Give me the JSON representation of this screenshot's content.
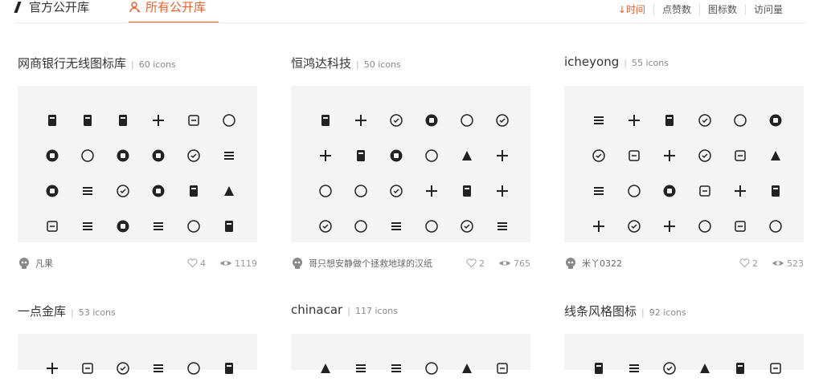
{
  "tabs": {
    "official": "官方公开库",
    "all": "所有公开库"
  },
  "sort": {
    "time": "↓时间",
    "likes": "点赞数",
    "icons": "图标数",
    "views": "访问量"
  },
  "cards": [
    {
      "name": "网商银行无线图标库",
      "count": "60 icons",
      "author": "凡果",
      "likes": "4",
      "views": "1119"
    },
    {
      "name": "恒鸿达科技",
      "count": "50 icons",
      "author": "哥只想安静做个拯救地球的汉纸",
      "likes": "2",
      "views": "765"
    },
    {
      "name": "icheyong",
      "count": "55 icons",
      "author": "米丫0322",
      "likes": "2",
      "views": "523"
    },
    {
      "name": "一点金库",
      "count": "53 icons"
    },
    {
      "name": "chinacar",
      "count": "117 icons"
    },
    {
      "name": "线条风格图标",
      "count": "92 icons"
    }
  ],
  "icon_names": [
    [
      "shield-check",
      "chat-bubble",
      "phone-call",
      "phone-book",
      "calendar-check",
      "user-circle",
      "link-broken",
      "pie-chart",
      "hand-coin",
      "list-doc",
      "calendar-grid",
      "card-circle",
      "upload-circle",
      "calculator-circle",
      "money-bag",
      "yen-circle",
      "check-circle",
      "doc-circle",
      "database",
      "trend-chart",
      "coupon-circle",
      "bar-chart",
      "scan-frame",
      "trash"
    ],
    [
      "link",
      "monitor-chat",
      "dollar-circle",
      "shield",
      "send",
      "card-phone",
      "id-card",
      "reply",
      "clipboard",
      "refresh",
      "user-card",
      "link-heart",
      "book",
      "folder-send",
      "forbidden",
      "router",
      "menu",
      "copy",
      "more-vertical",
      "printer-check",
      "add-screen",
      "eye",
      "all-badge",
      "recycle"
    ],
    [
      "search",
      "user",
      "arrow-right-circle",
      "arrow-circle",
      "crop",
      "badge-shield",
      "car-badge",
      "fingerprint",
      "fingerprint-2",
      "target",
      "car-char",
      "location",
      "magic-wand",
      "speedometer",
      "tag",
      "medical-kit",
      "wheel",
      "shield-lock",
      "pin",
      "phone-circle",
      "telephone",
      "telephone-2",
      "clock-screen",
      "user-list"
    ],
    [
      "brush",
      "lightbulb",
      "phone",
      "paper-plane",
      "compass-dark",
      "compass"
    ],
    [
      "bus",
      "phone-outline",
      "chevron-down",
      "calendar-star",
      "doc-yen",
      "truck"
    ],
    [
      "user-outline",
      "heart-outline",
      "users-outline",
      "location-outline",
      "settings-outline",
      "clock-outline"
    ]
  ]
}
